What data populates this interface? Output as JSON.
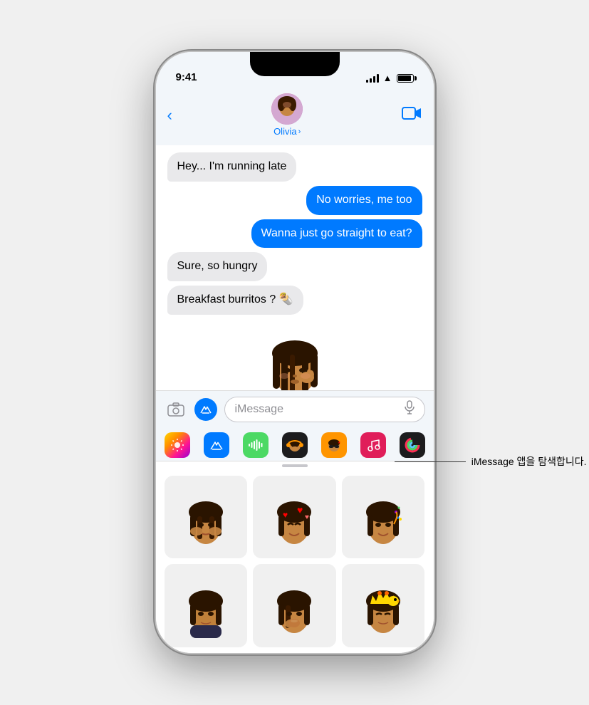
{
  "statusBar": {
    "time": "9:41",
    "batteryFull": true
  },
  "header": {
    "backLabel": "",
    "contactName": "Olivia",
    "chevron": "›",
    "videoIcon": "📹"
  },
  "messages": [
    {
      "id": 1,
      "type": "received",
      "text": "Hey... I'm running late"
    },
    {
      "id": 2,
      "type": "sent",
      "text": "No worries, me too"
    },
    {
      "id": 3,
      "type": "sent",
      "text": "Wanna just go straight to eat?"
    },
    {
      "id": 4,
      "type": "received",
      "text": "Sure, so hungry"
    },
    {
      "id": 5,
      "type": "received",
      "text": "Breakfast burritos ? 🌯"
    }
  ],
  "memoji": {
    "sticker": "🧑‍🦱"
  },
  "inputArea": {
    "placeholder": "iMessage",
    "cameraIcon": "📷",
    "appStoreIcon": "A",
    "micIcon": "🎙"
  },
  "appTray": {
    "icons": [
      {
        "name": "photos",
        "label": "🌅",
        "bg": "photos"
      },
      {
        "name": "app-store",
        "label": "A",
        "bg": "appstore"
      },
      {
        "name": "audio",
        "label": "🎵",
        "bg": "audio"
      },
      {
        "name": "memoji",
        "label": "😎",
        "bg": "memoji"
      },
      {
        "name": "animoji2",
        "label": "😜",
        "bg": "animoji"
      },
      {
        "name": "music",
        "label": "♪",
        "bg": "music"
      },
      {
        "name": "activity",
        "label": "⊙",
        "bg": "activity"
      }
    ]
  },
  "memojiGrid": [
    {
      "id": 1,
      "emoji": "🧑‍🦱"
    },
    {
      "id": 2,
      "emoji": "🧑‍🦱"
    },
    {
      "id": 3,
      "emoji": "🧑‍🦱"
    },
    {
      "id": 4,
      "emoji": "🧑‍🦱"
    },
    {
      "id": 5,
      "emoji": "🧑‍🦱"
    },
    {
      "id": 6,
      "emoji": "🧑‍🦱"
    }
  ],
  "annotation": {
    "text": "iMessage 앱을 탐색합니다."
  }
}
